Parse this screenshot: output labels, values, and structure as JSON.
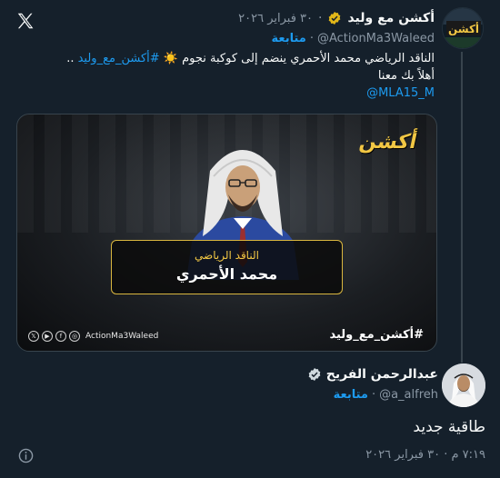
{
  "quoted": {
    "name": "أكشن مع وليد",
    "date": "٣٠ فبراير ٢٠٢٦",
    "handle": "@ActionMa3Waleed",
    "follow_label": "متابعة",
    "text_line1_prefix": "الناقد الرياضي محمد الأحمري ينضم إلى كوكبة نجوم",
    "text_line1_hashtag": "#أكشن_مع_وليد",
    "text_line1_suffix": "..",
    "text_line2": "أهلاً بك معنا",
    "text_line3": "@MLA15_M",
    "media": {
      "brand": "أكشن",
      "caption_title": "الناقد الرياضي",
      "caption_name": "محمد الأحمري",
      "hashtag": "#أكشن_مع_وليد",
      "social_handle": "ActionMa3Waleed",
      "social_icons": [
        "instagram-icon",
        "facebook-icon",
        "youtube-icon",
        "x-icon"
      ]
    }
  },
  "main": {
    "name": "عبدالرحمن الفريح",
    "handle": "@a_alfreh",
    "follow_label": "متابعة",
    "text": "طاقية جديد",
    "timestamp": "٧:١٩ م · ٣٠ فبراير ٢٠٢٦"
  },
  "colors": {
    "background": "#15202b",
    "accent": "#1d9bf0",
    "muted": "#8b98a5",
    "gold": "#f2c744"
  }
}
